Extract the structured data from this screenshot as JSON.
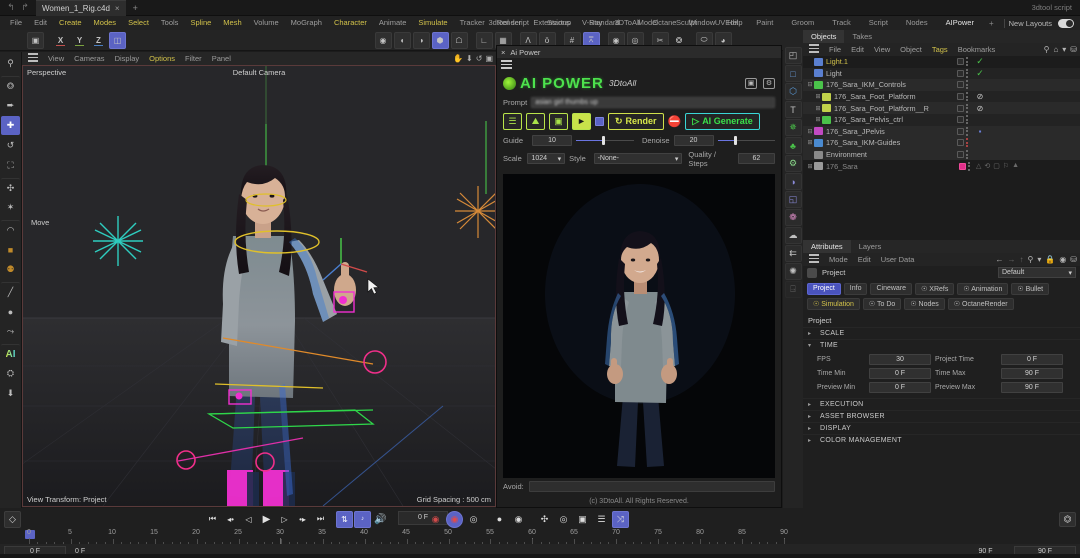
{
  "titlebar": {
    "undo_icon": "undo-icon",
    "redo_icon": "redo-icon",
    "document_tab": "Women_1_Rig.c4d",
    "close_label": "×",
    "add_tab": "+",
    "right_label": "3dtool script"
  },
  "menubar": {
    "items": [
      {
        "label": "File",
        "style": "normal"
      },
      {
        "label": "Edit",
        "style": "normal"
      },
      {
        "label": "Create",
        "style": "hl"
      },
      {
        "label": "Modes",
        "style": "hl"
      },
      {
        "label": "Select",
        "style": "hl"
      },
      {
        "label": "Tools",
        "style": "normal"
      },
      {
        "label": "Spline",
        "style": "hl"
      },
      {
        "label": "Mesh",
        "style": "hl"
      },
      {
        "label": "Volume",
        "style": "normal"
      },
      {
        "label": "MoGraph",
        "style": "normal"
      },
      {
        "label": "Character",
        "style": "hl"
      },
      {
        "label": "Animate",
        "style": "normal"
      },
      {
        "label": "Simulate",
        "style": "hl"
      },
      {
        "label": "Tracker",
        "style": "normal"
      },
      {
        "label": "Render",
        "style": "normal"
      },
      {
        "label": "Extensions",
        "style": "normal"
      },
      {
        "label": "V-Ray",
        "style": "normal"
      },
      {
        "label": "3DToAll",
        "style": "normal"
      },
      {
        "label": "Octane",
        "style": "normal"
      },
      {
        "label": "Window",
        "style": "normal"
      },
      {
        "label": "Help",
        "style": "normal"
      }
    ]
  },
  "layouts": {
    "tabs": [
      {
        "label": "3dtool script",
        "selected": false
      },
      {
        "label": "Startup",
        "selected": false
      },
      {
        "label": "Standard",
        "selected": false
      },
      {
        "label": "Model",
        "selected": false
      },
      {
        "label": "Sculpt",
        "selected": false
      },
      {
        "label": "UVEdit",
        "selected": false
      },
      {
        "label": "Paint",
        "selected": false
      },
      {
        "label": "Groom",
        "selected": false
      },
      {
        "label": "Track",
        "selected": false
      },
      {
        "label": "Script",
        "selected": false
      },
      {
        "label": "Nodes",
        "selected": false
      },
      {
        "label": "AIPower",
        "selected": true
      }
    ],
    "add": "+",
    "new_layouts": "New Layouts"
  },
  "icon_toolbar": {
    "left": [
      {
        "name": "undo-redo-icon",
        "glyph": "⬚"
      },
      {
        "name": "axis-x-icon",
        "glyph": "X",
        "axis": "X"
      },
      {
        "name": "axis-y-icon",
        "glyph": "Y",
        "axis": "Y"
      },
      {
        "name": "axis-z-icon",
        "glyph": "Z",
        "axis": "Z"
      },
      {
        "name": "world-coordinate-icon",
        "glyph": "▣",
        "on": true
      }
    ],
    "middle": [
      {
        "name": "point-mode-icon",
        "glyph": "○"
      },
      {
        "name": "edge-mode-icon",
        "glyph": "◔"
      },
      {
        "name": "polygon-mode-icon",
        "glyph": "◑"
      },
      {
        "name": "model-mode-icon",
        "glyph": "⬢",
        "on": true
      },
      {
        "name": "object-mode-icon",
        "glyph": "⬟"
      },
      {
        "name": "texture-mode-icon",
        "glyph": "⌙"
      },
      {
        "name": "workplane-icon",
        "glyph": "▧"
      },
      {
        "name": "enable-axis-icon",
        "glyph": "Ʉ"
      },
      {
        "name": "object-axis-icon",
        "glyph": "ö"
      },
      {
        "name": "grid-snap-icon",
        "glyph": "#"
      },
      {
        "name": "snap-settings-icon",
        "glyph": "⩞",
        "on": true
      },
      {
        "name": "quantize-icon",
        "glyph": "◎"
      },
      {
        "name": "workplane-lock-icon",
        "glyph": "◉"
      },
      {
        "name": "deformer-icon",
        "glyph": "✄"
      },
      {
        "name": "symmetry-icon",
        "glyph": "⁂"
      },
      {
        "name": "render-view-icon",
        "glyph": "⬭"
      },
      {
        "name": "render-region-icon",
        "glyph": "◕"
      }
    ],
    "right": [
      {
        "name": "render-picture-icon",
        "glyph": "▤"
      },
      {
        "name": "render-queue-icon",
        "glyph": "▥"
      },
      {
        "name": "render-settings-icon",
        "glyph": "▦"
      },
      {
        "name": "ai-power-icon",
        "glyph": "AI",
        "ai": true
      },
      {
        "name": "octane-icon",
        "glyph": "○"
      }
    ]
  },
  "left_tools": [
    {
      "name": "search-tool-icon",
      "glyph": "⚲"
    },
    {
      "name": "live-selection-icon",
      "glyph": "⭗"
    },
    {
      "name": "move-select-icon",
      "glyph": "⯈"
    },
    {
      "name": "move-tool-icon",
      "glyph": "✚",
      "active": true
    },
    {
      "name": "rotate-tool-icon",
      "glyph": "↺"
    },
    {
      "name": "scale-tool-icon",
      "glyph": "⛶"
    },
    {
      "name": "magnet-tool-icon",
      "glyph": "✣"
    },
    {
      "name": "brush-deform-icon",
      "glyph": "✦"
    },
    {
      "name": "arc-tool-icon",
      "glyph": "◠"
    },
    {
      "name": "material-cube-icon",
      "glyph": "■"
    },
    {
      "name": "material-sphere-icon",
      "glyph": "⚉"
    },
    {
      "name": "paint-brush-icon",
      "glyph": "╱"
    },
    {
      "name": "color-picker-icon",
      "glyph": "●"
    },
    {
      "name": "spline-pen-icon",
      "glyph": "⤳"
    },
    {
      "name": "ai-tool-icon",
      "glyph": "AI",
      "ai": true
    },
    {
      "name": "deform-tool-icon",
      "glyph": "⛭"
    },
    {
      "name": "download-tool-icon",
      "glyph": "⬇"
    }
  ],
  "viewport": {
    "menus": [
      {
        "label": "View",
        "style": "normal"
      },
      {
        "label": "Cameras",
        "style": "normal"
      },
      {
        "label": "Display",
        "style": "normal"
      },
      {
        "label": "Options",
        "style": "hl"
      },
      {
        "label": "Filter",
        "style": "normal"
      },
      {
        "label": "Panel",
        "style": "normal"
      }
    ],
    "corner_icons": [
      "pan-view-icon",
      "dolly-view-icon",
      "rotate-view-icon",
      "maximize-view-icon"
    ],
    "label_topleft": "Perspective",
    "label_topcenter": "Default Camera",
    "label_bottomleft": "View Transform: Project",
    "label_bottomright": "Grid Spacing : 500 cm",
    "tool_hint": "Move"
  },
  "ai_power": {
    "window_title": "Ai Power",
    "close_glyph": "×",
    "logo_main": "AI POWER",
    "logo_sub": "3DtoAll",
    "header_icons": [
      "gallery-icon",
      "settings-gear-icon"
    ],
    "prompt_label": "Prompt",
    "prompt_value": "asian girl thumbs up",
    "buttons": [
      {
        "name": "text-to-image-button",
        "glyph": "☰"
      },
      {
        "name": "image-to-image-button",
        "glyph": "⛰"
      },
      {
        "name": "video-frame-button",
        "glyph": "⬛"
      },
      {
        "name": "batch-render-button",
        "glyph": "▶",
        "filled": true
      }
    ],
    "checkbox_name": "auto-checkbox",
    "render_label": "Render",
    "render_icon": "refresh-icon",
    "no_icon": "render-disabled-icon",
    "generate_label": "AI Generate",
    "generate_icon": "play-icon",
    "guide_label": "Guide",
    "guide_value": "10",
    "denoise_label": "Denoise",
    "denoise_value": "20",
    "scale_label": "Scale",
    "scale_value": "1024",
    "style_label": "Style",
    "style_value": "-None-",
    "quality_label": "Quality / Steps",
    "quality_value": "62",
    "avoid_label": "Avoid:",
    "avoid_value": "",
    "copyright": "(c) 3DtoAll. All Rights Reserved."
  },
  "mid_tools": [
    {
      "name": "scene-nodes-icon",
      "glyph": "◰"
    },
    {
      "name": "primitive-cube-icon",
      "glyph": "□"
    },
    {
      "name": "generator-icon",
      "glyph": "⬡"
    },
    {
      "name": "text-object-icon",
      "glyph": "T"
    },
    {
      "name": "spline-point-icon",
      "glyph": "✵"
    },
    {
      "name": "array-icon",
      "glyph": "♣"
    },
    {
      "name": "gear-object-icon",
      "glyph": "⚙"
    },
    {
      "name": "deformer-twist-icon",
      "glyph": "◖"
    },
    {
      "name": "scene-camera-icon",
      "glyph": "◱"
    },
    {
      "name": "light-object-icon",
      "glyph": "❁"
    },
    {
      "name": "environment-icon",
      "glyph": "⊕"
    },
    {
      "name": "xpresso-icon",
      "glyph": "⎇"
    },
    {
      "name": "effector-icon",
      "glyph": "✺"
    },
    {
      "name": "disabled-tool-icon",
      "glyph": "⊘"
    }
  ],
  "objects_panel": {
    "tabs": [
      {
        "label": "Objects",
        "selected": true
      },
      {
        "label": "Takes",
        "selected": false
      }
    ],
    "menus": [
      {
        "label": "File",
        "style": "normal"
      },
      {
        "label": "Edit",
        "style": "normal"
      },
      {
        "label": "View",
        "style": "normal"
      },
      {
        "label": "Object",
        "style": "normal"
      },
      {
        "label": "Tags",
        "style": "hl"
      },
      {
        "label": "Bookmarks",
        "style": "normal"
      }
    ],
    "icons": [
      "search-icon",
      "home-icon",
      "filter-icon",
      "detach-icon"
    ],
    "rows": [
      {
        "name": "Light.1",
        "indent": 0,
        "color": "#d2c24a",
        "iconColor": "#5a7fd0",
        "expander": "",
        "tag": "check",
        "dots": "normal"
      },
      {
        "name": "Light",
        "indent": 0,
        "color": "#b9b9b9",
        "iconColor": "#5a7fd0",
        "expander": "",
        "tag": "check",
        "dots": "normal"
      },
      {
        "name": "176_Sara_IKM_Controls",
        "indent": 0,
        "color": "#b9b9b9",
        "iconColor": "#4ac24a",
        "expander": "-",
        "tag": "",
        "dots": "normal"
      },
      {
        "name": "176_Sara_Foot_Platform",
        "indent": 1,
        "color": "#b9b9b9",
        "iconColor": "#c2d24a",
        "expander": "+",
        "tag": "no",
        "dots": "normal"
      },
      {
        "name": "176_Sara_Foot_Platform__R",
        "indent": 1,
        "color": "#b9b9b9",
        "iconColor": "#c2d24a",
        "expander": "+",
        "tag": "no",
        "dots": "normal"
      },
      {
        "name": "176_Sara_Pelvis_ctrl",
        "indent": 1,
        "color": "#b9b9b9",
        "iconColor": "#4ac24a",
        "expander": "+",
        "tag": "",
        "dots": "normal"
      },
      {
        "name": "176_Sara_JPelvis",
        "indent": 0,
        "color": "#b9b9b9",
        "iconColor": "#c24ac2",
        "expander": "-",
        "tag": "blue",
        "dots": "normal"
      },
      {
        "name": "176_Sara_IKM-Guides",
        "indent": 0,
        "color": "#b9b9b9",
        "iconColor": "#4a8ad0",
        "expander": "+",
        "tag": "",
        "dots": "red"
      },
      {
        "name": "Environment",
        "indent": 0,
        "color": "#b9b9b9",
        "iconColor": "#8a8a8a",
        "expander": "",
        "tag": "",
        "dots": "normal"
      },
      {
        "name": "176_Sara",
        "indent": 0,
        "color": "#8a8a8a",
        "iconColor": "#9a9a9a",
        "expander": "+",
        "tag": "tagrow",
        "dots": "pink"
      }
    ]
  },
  "attributes_panel": {
    "tabs": [
      {
        "label": "Attributes",
        "selected": true
      },
      {
        "label": "Layers",
        "selected": false
      }
    ],
    "menus": [
      {
        "label": "Mode",
        "style": "normal"
      },
      {
        "label": "Edit",
        "style": "normal"
      },
      {
        "label": "User Data",
        "style": "normal"
      }
    ],
    "nav_icons": [
      "back-arrow-icon",
      "forward-arrow-icon",
      "up-arrow-icon",
      "search-icon",
      "filter-icon",
      "lock-icon",
      "history-icon",
      "detach-icon"
    ],
    "object_label": "Project",
    "preset_value": "Default",
    "tabs_row": [
      {
        "label": "Project",
        "selected": true
      },
      {
        "label": "Info",
        "selected": false
      },
      {
        "label": "Cineware",
        "selected": false
      },
      {
        "label": "XRefs",
        "selected": false,
        "lock": true
      },
      {
        "label": "Animation",
        "selected": false,
        "lock": true
      },
      {
        "label": "Bullet",
        "selected": false,
        "lock": true
      },
      {
        "label": "Simulation",
        "selected": false,
        "lock": true,
        "yellow": true
      },
      {
        "label": "To Do",
        "selected": false,
        "lock": true
      },
      {
        "label": "Nodes",
        "selected": false,
        "lock": true
      },
      {
        "label": "OctaneRender",
        "selected": false,
        "lock": true
      }
    ],
    "section_title": "Project",
    "sections": [
      {
        "label": "SCALE",
        "open": false
      },
      {
        "label": "TIME",
        "open": true
      },
      {
        "label": "EXECUTION",
        "open": false
      },
      {
        "label": "ASSET BROWSER",
        "open": false
      },
      {
        "label": "DISPLAY",
        "open": false
      },
      {
        "label": "COLOR MANAGEMENT",
        "open": false
      }
    ],
    "time_fields": [
      {
        "label": "FPS",
        "value": "30"
      },
      {
        "label": "Project Time",
        "value": "0 F"
      },
      {
        "label": "Time Min",
        "value": "0 F"
      },
      {
        "label": "Time Max",
        "value": "90 F"
      },
      {
        "label": "Preview Min",
        "value": "0 F"
      },
      {
        "label": "Preview Max",
        "value": "90 F"
      }
    ]
  },
  "timeline": {
    "key_icon": "record-keyframe-icon",
    "transport": [
      {
        "name": "go-to-start-button",
        "glyph": "⏮"
      },
      {
        "name": "previous-key-button",
        "glyph": "◃●"
      },
      {
        "name": "step-back-button",
        "glyph": "◁"
      },
      {
        "name": "play-button",
        "glyph": "▶"
      },
      {
        "name": "step-forward-button",
        "glyph": "▷"
      },
      {
        "name": "next-key-button",
        "glyph": "●▷"
      },
      {
        "name": "go-to-end-button",
        "glyph": "⏭"
      }
    ],
    "loop_button": "loop-playback-button",
    "sound_button": "sound-toggle-button",
    "audio_button": "audio-settings-button",
    "current_frame": "0 F",
    "record_buttons": [
      {
        "name": "record-active-button",
        "glyph": "◉",
        "color": "#c0392b"
      },
      {
        "name": "autokey-button",
        "glyph": "◉",
        "color": "#c0392b",
        "active": true
      },
      {
        "name": "keyframe-selection-button",
        "glyph": "◎",
        "color": "#e0e0e0"
      },
      {
        "name": "position-key-button",
        "glyph": "ⓟ",
        "color": "#e0e0e0"
      },
      {
        "name": "rotation-key-button",
        "glyph": "⊚",
        "color": "#e0e0e0"
      },
      {
        "name": "scale-key-button",
        "glyph": "✣",
        "color": "#e0e0e0"
      },
      {
        "name": "param-key-button",
        "glyph": "⊛",
        "color": "#e0e0e0"
      },
      {
        "name": "pla-key-button",
        "glyph": "⟳",
        "color": "#e0e0e0"
      },
      {
        "name": "auto-key-toggle",
        "glyph": "≡",
        "color": "#e0e0e0"
      },
      {
        "name": "keyframe-filter-button",
        "glyph": "⤨",
        "color": "#fff",
        "active": true
      }
    ],
    "graph_button": "timeline-graph-button",
    "ruler_start": 0,
    "ruler_end": 90,
    "ruler_ticks": [
      0,
      5,
      10,
      15,
      20,
      25,
      30,
      35,
      40,
      45,
      50,
      55,
      60,
      65,
      70,
      75,
      80,
      85,
      90
    ],
    "playhead_frame": 0,
    "range_start_left": "0 F",
    "range_start_right": "0 F",
    "range_end_left": "90 F",
    "range_end_right": "90 F"
  },
  "colors": {
    "accent_blue": "#5b63c4",
    "accent_green": "#4de24d",
    "accent_yellow": "#d2c24a",
    "accent_cyan": "#3ad6d6",
    "panel_bg": "#1f1f1f",
    "toolbar_bg": "#242424"
  }
}
